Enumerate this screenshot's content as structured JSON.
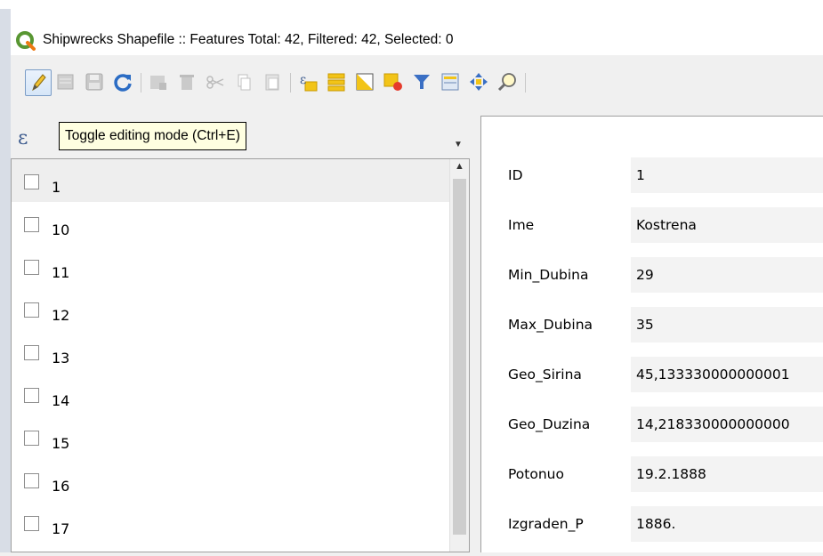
{
  "window": {
    "title": "Shipwrecks Shapefile :: Features Total: 42, Filtered: 42, Selected: 0"
  },
  "toolbar": {
    "buttons": [
      {
        "name": "toggle-editing",
        "icon": "pencil-icon",
        "active": true
      },
      {
        "name": "multi-edit",
        "icon": "multi-edit-icon"
      },
      {
        "name": "save-edits",
        "icon": "save-icon"
      },
      {
        "name": "reload",
        "icon": "reload-icon"
      },
      {
        "name": "add-feature",
        "icon": "add-feature-icon"
      },
      {
        "name": "delete-feature",
        "icon": "delete-icon"
      },
      {
        "name": "cut",
        "icon": "scissors-icon"
      },
      {
        "name": "copy",
        "icon": "copy-icon"
      },
      {
        "name": "paste",
        "icon": "paste-icon"
      },
      {
        "name": "select-by-expression",
        "icon": "expression-select-icon"
      },
      {
        "name": "select-all",
        "icon": "select-all-icon"
      },
      {
        "name": "invert-selection",
        "icon": "invert-selection-icon"
      },
      {
        "name": "deselect-all",
        "icon": "deselect-icon"
      },
      {
        "name": "filter",
        "icon": "filter-icon"
      },
      {
        "name": "move-selection-to-top",
        "icon": "move-top-icon"
      },
      {
        "name": "pan-to-selected",
        "icon": "pan-icon"
      },
      {
        "name": "zoom-to-selected",
        "icon": "zoom-icon"
      }
    ]
  },
  "tooltip": {
    "text": "Toggle editing mode (Ctrl+E)"
  },
  "list": {
    "items": [
      "1",
      "10",
      "11",
      "12",
      "13",
      "14",
      "15",
      "16",
      "17"
    ]
  },
  "form": {
    "fields": [
      {
        "key": "ID",
        "value": "1"
      },
      {
        "key": "Ime",
        "value": "Kostrena"
      },
      {
        "key": "Min_Dubina",
        "value": "29"
      },
      {
        "key": "Max_Dubina",
        "value": "35"
      },
      {
        "key": "Geo_Sirina",
        "value": "45,133330000000001"
      },
      {
        "key": "Geo_Duzina",
        "value": "14,218330000000000"
      },
      {
        "key": "Potonuo",
        "value": "19.2.1888"
      },
      {
        "key": "Izgraden_P",
        "value": "1886."
      }
    ]
  }
}
